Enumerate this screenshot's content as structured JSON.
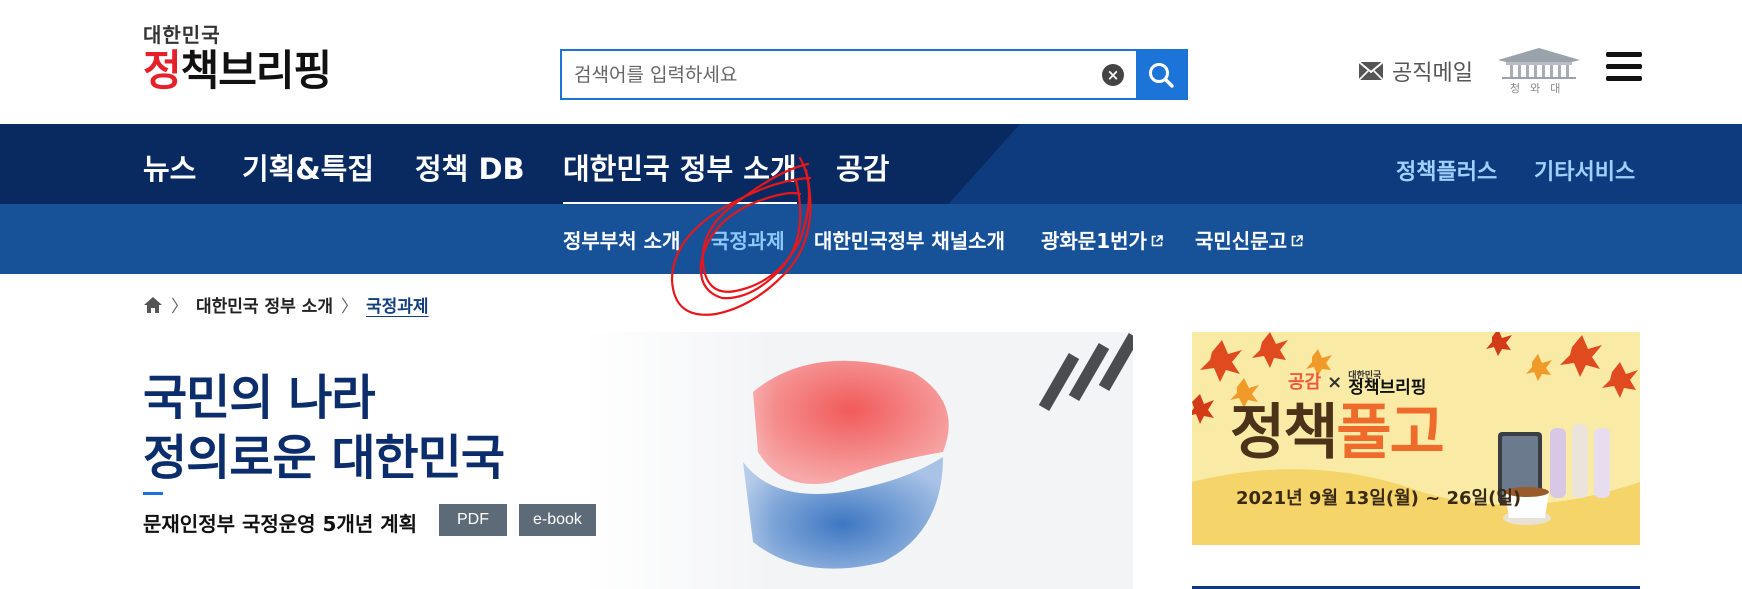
{
  "header": {
    "logo_small": "대한민국",
    "logo_main_pre": "정",
    "logo_main_post": "책브리핑",
    "search": {
      "placeholder": "검색어를 입력하세요",
      "clear_icon": "clear-circle-icon",
      "search_icon": "magnifier-icon"
    },
    "mail_label": "공직메일",
    "bluehouse_label": "청와대",
    "menu_icon": "hamburger-menu-icon"
  },
  "gnb": {
    "items": [
      {
        "label": "뉴스"
      },
      {
        "label": "기획&특집"
      },
      {
        "label": "정책 DB"
      },
      {
        "label": "대한민국 정부 소개",
        "active": true
      },
      {
        "label": "공감"
      }
    ],
    "right": [
      {
        "label": "정책플러스"
      },
      {
        "label": "기타서비스"
      }
    ]
  },
  "sub_gnb": {
    "items": [
      {
        "label": "정부부처 소개"
      },
      {
        "label": "국정과제",
        "active": true
      },
      {
        "label": "대한민국정부 채널소개"
      },
      {
        "label": "광화문1번가",
        "external": true
      },
      {
        "label": "국민신문고",
        "external": true
      }
    ]
  },
  "breadcrumb": {
    "home_icon": "home-icon",
    "items": [
      "대한민국 정부 소개",
      "국정과제"
    ]
  },
  "hero": {
    "title_line1": "국민의 나라",
    "title_line2": "정의로운 대한민국",
    "subtitle": "문재인정부 국정운영 5개년 계획",
    "pdf_label": "PDF",
    "ebook_label": "e-book"
  },
  "banner": {
    "top_left": "공감",
    "top_sep": "×",
    "top_brand_small": "대한민국",
    "top_brand": "정책브리핑",
    "title_pre": "정책",
    "title_accent": "풀고",
    "date": "2021년 9월 13일(월) ~ 26일(일)"
  },
  "colors": {
    "brand_blue": "#1d74d8",
    "gnb_dark": "#092a61",
    "gnb": "#0e3b7d",
    "sub_gnb": "#175299",
    "logo_red": "#e6202b",
    "annotation_red": "#e8161a"
  }
}
